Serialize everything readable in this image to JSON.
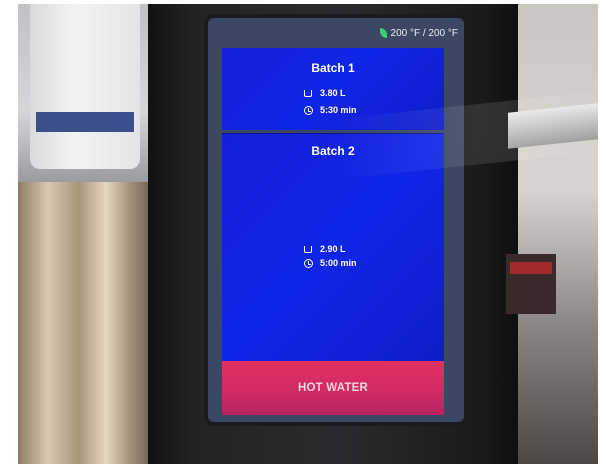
{
  "status_bar": {
    "temperature": "200 °F / 200 °F",
    "leaf_icon": "leaf-icon"
  },
  "batches": [
    {
      "title": "Batch 1",
      "volume": "3.80  L",
      "time": "5:30 min"
    },
    {
      "title": "Batch 2",
      "volume": "2.90  L",
      "time": "5:00 min"
    }
  ],
  "hot_water_button": {
    "label": "HOT WATER"
  },
  "colors": {
    "panel_blue": "#1320d8",
    "button_pink": "#d22a66",
    "leaf_green": "#3fcf6f"
  }
}
